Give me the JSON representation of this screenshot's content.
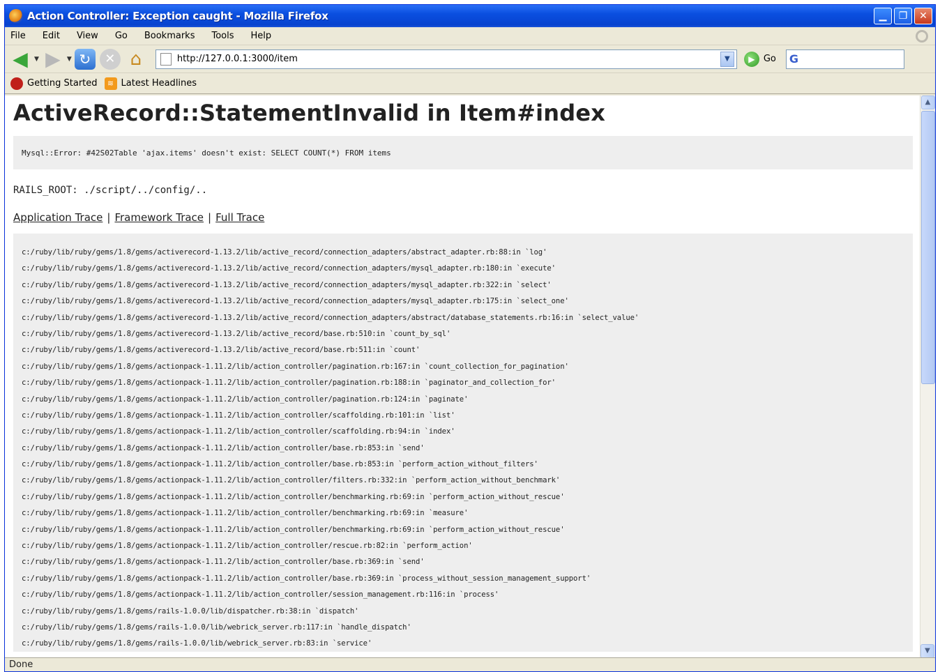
{
  "window": {
    "title": "Action Controller: Exception caught - Mozilla Firefox"
  },
  "menu": [
    "File",
    "Edit",
    "View",
    "Go",
    "Bookmarks",
    "Tools",
    "Help"
  ],
  "toolbar": {
    "url": "http://127.0.0.1:3000/item",
    "go_label": "Go",
    "search_engine_glyph": "G"
  },
  "bookmarks": [
    {
      "label": "Getting Started",
      "icon": "firefox-start-icon"
    },
    {
      "label": "Latest Headlines",
      "icon": "rss-icon"
    }
  ],
  "page": {
    "heading": "ActiveRecord::StatementInvalid in Item#index",
    "error_message": "Mysql::Error: #42S02Table 'ajax.items' doesn't exist: SELECT COUNT(*) FROM items",
    "rails_root": "RAILS_ROOT: ./script/../config/..",
    "trace_links": [
      "Application Trace",
      "Framework Trace",
      "Full Trace"
    ],
    "trace_separator": "|",
    "trace_lines": [
      "c:/ruby/lib/ruby/gems/1.8/gems/activerecord-1.13.2/lib/active_record/connection_adapters/abstract_adapter.rb:88:in `log'",
      "c:/ruby/lib/ruby/gems/1.8/gems/activerecord-1.13.2/lib/active_record/connection_adapters/mysql_adapter.rb:180:in `execute'",
      "c:/ruby/lib/ruby/gems/1.8/gems/activerecord-1.13.2/lib/active_record/connection_adapters/mysql_adapter.rb:322:in `select'",
      "c:/ruby/lib/ruby/gems/1.8/gems/activerecord-1.13.2/lib/active_record/connection_adapters/mysql_adapter.rb:175:in `select_one'",
      "c:/ruby/lib/ruby/gems/1.8/gems/activerecord-1.13.2/lib/active_record/connection_adapters/abstract/database_statements.rb:16:in `select_value'",
      "c:/ruby/lib/ruby/gems/1.8/gems/activerecord-1.13.2/lib/active_record/base.rb:510:in `count_by_sql'",
      "c:/ruby/lib/ruby/gems/1.8/gems/activerecord-1.13.2/lib/active_record/base.rb:511:in `count'",
      "c:/ruby/lib/ruby/gems/1.8/gems/actionpack-1.11.2/lib/action_controller/pagination.rb:167:in `count_collection_for_pagination'",
      "c:/ruby/lib/ruby/gems/1.8/gems/actionpack-1.11.2/lib/action_controller/pagination.rb:188:in `paginator_and_collection_for'",
      "c:/ruby/lib/ruby/gems/1.8/gems/actionpack-1.11.2/lib/action_controller/pagination.rb:124:in `paginate'",
      "c:/ruby/lib/ruby/gems/1.8/gems/actionpack-1.11.2/lib/action_controller/scaffolding.rb:101:in `list'",
      "c:/ruby/lib/ruby/gems/1.8/gems/actionpack-1.11.2/lib/action_controller/scaffolding.rb:94:in `index'",
      "c:/ruby/lib/ruby/gems/1.8/gems/actionpack-1.11.2/lib/action_controller/base.rb:853:in `send'",
      "c:/ruby/lib/ruby/gems/1.8/gems/actionpack-1.11.2/lib/action_controller/base.rb:853:in `perform_action_without_filters'",
      "c:/ruby/lib/ruby/gems/1.8/gems/actionpack-1.11.2/lib/action_controller/filters.rb:332:in `perform_action_without_benchmark'",
      "c:/ruby/lib/ruby/gems/1.8/gems/actionpack-1.11.2/lib/action_controller/benchmarking.rb:69:in `perform_action_without_rescue'",
      "c:/ruby/lib/ruby/gems/1.8/gems/actionpack-1.11.2/lib/action_controller/benchmarking.rb:69:in `measure'",
      "c:/ruby/lib/ruby/gems/1.8/gems/actionpack-1.11.2/lib/action_controller/benchmarking.rb:69:in `perform_action_without_rescue'",
      "c:/ruby/lib/ruby/gems/1.8/gems/actionpack-1.11.2/lib/action_controller/rescue.rb:82:in `perform_action'",
      "c:/ruby/lib/ruby/gems/1.8/gems/actionpack-1.11.2/lib/action_controller/base.rb:369:in `send'",
      "c:/ruby/lib/ruby/gems/1.8/gems/actionpack-1.11.2/lib/action_controller/base.rb:369:in `process_without_session_management_support'",
      "c:/ruby/lib/ruby/gems/1.8/gems/actionpack-1.11.2/lib/action_controller/session_management.rb:116:in `process'",
      "c:/ruby/lib/ruby/gems/1.8/gems/rails-1.0.0/lib/dispatcher.rb:38:in `dispatch'",
      "c:/ruby/lib/ruby/gems/1.8/gems/rails-1.0.0/lib/webrick_server.rb:117:in `handle_dispatch'",
      "c:/ruby/lib/ruby/gems/1.8/gems/rails-1.0.0/lib/webrick_server.rb:83:in `service'"
    ]
  },
  "status": {
    "text": "Done"
  },
  "colors": {
    "titlebar": "#0a4fe0",
    "chrome": "#ece9d8",
    "code_bg": "#eeeeee"
  }
}
